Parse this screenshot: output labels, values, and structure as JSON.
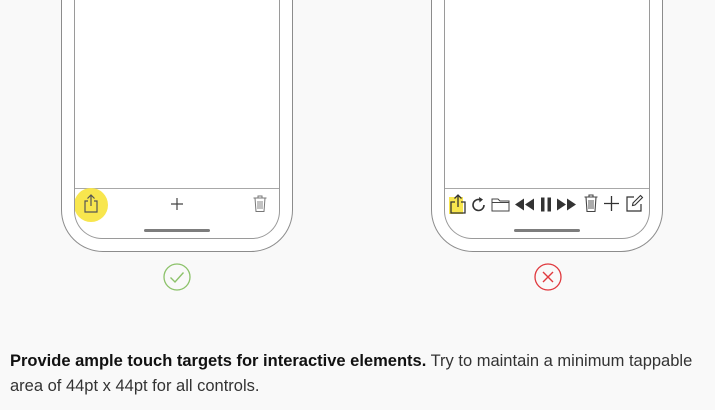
{
  "good_example": {
    "toolbar_icons": [
      "share-icon",
      "plus-icon",
      "trash-icon"
    ],
    "highlight_color": "#f8e64e",
    "verdict_icon": "checkmark-circle-icon",
    "verdict_color": "#8cc26a"
  },
  "bad_example": {
    "toolbar_icons": [
      "share-icon",
      "refresh-icon",
      "folder-icon",
      "rewind-icon",
      "pause-icon",
      "fast-forward-icon",
      "trash-icon",
      "plus-icon",
      "compose-icon"
    ],
    "highlight_color": "#f8e64e",
    "verdict_icon": "x-circle-icon",
    "verdict_color": "#e0393e"
  },
  "caption": {
    "bold": "Provide ample touch targets for interactive elements.",
    "rest": " Try to maintain a minimum tappable area of 44pt x 44pt for all controls."
  }
}
